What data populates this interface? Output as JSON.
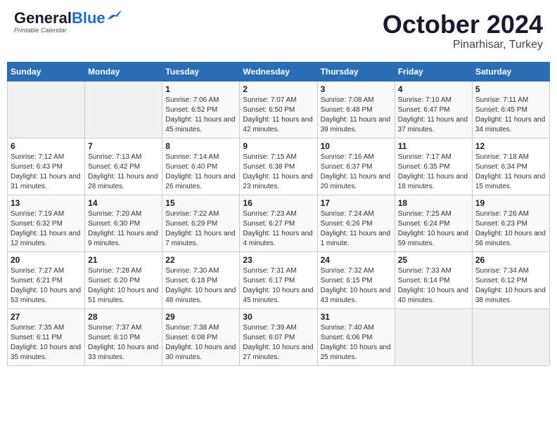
{
  "header": {
    "logo_general": "General",
    "logo_blue": "Blue",
    "month": "October 2024",
    "location": "Pinarhisar, Turkey"
  },
  "days_of_week": [
    "Sunday",
    "Monday",
    "Tuesday",
    "Wednesday",
    "Thursday",
    "Friday",
    "Saturday"
  ],
  "weeks": [
    [
      {
        "day": "",
        "sunrise": "",
        "sunset": "",
        "daylight": ""
      },
      {
        "day": "",
        "sunrise": "",
        "sunset": "",
        "daylight": ""
      },
      {
        "day": "1",
        "sunrise": "Sunrise: 7:06 AM",
        "sunset": "Sunset: 6:52 PM",
        "daylight": "Daylight: 11 hours and 45 minutes."
      },
      {
        "day": "2",
        "sunrise": "Sunrise: 7:07 AM",
        "sunset": "Sunset: 6:50 PM",
        "daylight": "Daylight: 11 hours and 42 minutes."
      },
      {
        "day": "3",
        "sunrise": "Sunrise: 7:08 AM",
        "sunset": "Sunset: 6:48 PM",
        "daylight": "Daylight: 11 hours and 39 minutes."
      },
      {
        "day": "4",
        "sunrise": "Sunrise: 7:10 AM",
        "sunset": "Sunset: 6:47 PM",
        "daylight": "Daylight: 11 hours and 37 minutes."
      },
      {
        "day": "5",
        "sunrise": "Sunrise: 7:11 AM",
        "sunset": "Sunset: 6:45 PM",
        "daylight": "Daylight: 11 hours and 34 minutes."
      }
    ],
    [
      {
        "day": "6",
        "sunrise": "Sunrise: 7:12 AM",
        "sunset": "Sunset: 6:43 PM",
        "daylight": "Daylight: 11 hours and 31 minutes."
      },
      {
        "day": "7",
        "sunrise": "Sunrise: 7:13 AM",
        "sunset": "Sunset: 6:42 PM",
        "daylight": "Daylight: 11 hours and 28 minutes."
      },
      {
        "day": "8",
        "sunrise": "Sunrise: 7:14 AM",
        "sunset": "Sunset: 6:40 PM",
        "daylight": "Daylight: 11 hours and 26 minutes."
      },
      {
        "day": "9",
        "sunrise": "Sunrise: 7:15 AM",
        "sunset": "Sunset: 6:38 PM",
        "daylight": "Daylight: 11 hours and 23 minutes."
      },
      {
        "day": "10",
        "sunrise": "Sunrise: 7:16 AM",
        "sunset": "Sunset: 6:37 PM",
        "daylight": "Daylight: 11 hours and 20 minutes."
      },
      {
        "day": "11",
        "sunrise": "Sunrise: 7:17 AM",
        "sunset": "Sunset: 6:35 PM",
        "daylight": "Daylight: 11 hours and 18 minutes."
      },
      {
        "day": "12",
        "sunrise": "Sunrise: 7:18 AM",
        "sunset": "Sunset: 6:34 PM",
        "daylight": "Daylight: 11 hours and 15 minutes."
      }
    ],
    [
      {
        "day": "13",
        "sunrise": "Sunrise: 7:19 AM",
        "sunset": "Sunset: 6:32 PM",
        "daylight": "Daylight: 11 hours and 12 minutes."
      },
      {
        "day": "14",
        "sunrise": "Sunrise: 7:20 AM",
        "sunset": "Sunset: 6:30 PM",
        "daylight": "Daylight: 11 hours and 9 minutes."
      },
      {
        "day": "15",
        "sunrise": "Sunrise: 7:22 AM",
        "sunset": "Sunset: 6:29 PM",
        "daylight": "Daylight: 11 hours and 7 minutes."
      },
      {
        "day": "16",
        "sunrise": "Sunrise: 7:23 AM",
        "sunset": "Sunset: 6:27 PM",
        "daylight": "Daylight: 11 hours and 4 minutes."
      },
      {
        "day": "17",
        "sunrise": "Sunrise: 7:24 AM",
        "sunset": "Sunset: 6:26 PM",
        "daylight": "Daylight: 11 hours and 1 minute."
      },
      {
        "day": "18",
        "sunrise": "Sunrise: 7:25 AM",
        "sunset": "Sunset: 6:24 PM",
        "daylight": "Daylight: 10 hours and 59 minutes."
      },
      {
        "day": "19",
        "sunrise": "Sunrise: 7:26 AM",
        "sunset": "Sunset: 6:23 PM",
        "daylight": "Daylight: 10 hours and 56 minutes."
      }
    ],
    [
      {
        "day": "20",
        "sunrise": "Sunrise: 7:27 AM",
        "sunset": "Sunset: 6:21 PM",
        "daylight": "Daylight: 10 hours and 53 minutes."
      },
      {
        "day": "21",
        "sunrise": "Sunrise: 7:28 AM",
        "sunset": "Sunset: 6:20 PM",
        "daylight": "Daylight: 10 hours and 51 minutes."
      },
      {
        "day": "22",
        "sunrise": "Sunrise: 7:30 AM",
        "sunset": "Sunset: 6:18 PM",
        "daylight": "Daylight: 10 hours and 48 minutes."
      },
      {
        "day": "23",
        "sunrise": "Sunrise: 7:31 AM",
        "sunset": "Sunset: 6:17 PM",
        "daylight": "Daylight: 10 hours and 45 minutes."
      },
      {
        "day": "24",
        "sunrise": "Sunrise: 7:32 AM",
        "sunset": "Sunset: 6:15 PM",
        "daylight": "Daylight: 10 hours and 43 minutes."
      },
      {
        "day": "25",
        "sunrise": "Sunrise: 7:33 AM",
        "sunset": "Sunset: 6:14 PM",
        "daylight": "Daylight: 10 hours and 40 minutes."
      },
      {
        "day": "26",
        "sunrise": "Sunrise: 7:34 AM",
        "sunset": "Sunset: 6:12 PM",
        "daylight": "Daylight: 10 hours and 38 minutes."
      }
    ],
    [
      {
        "day": "27",
        "sunrise": "Sunrise: 7:35 AM",
        "sunset": "Sunset: 6:11 PM",
        "daylight": "Daylight: 10 hours and 35 minutes."
      },
      {
        "day": "28",
        "sunrise": "Sunrise: 7:37 AM",
        "sunset": "Sunset: 6:10 PM",
        "daylight": "Daylight: 10 hours and 33 minutes."
      },
      {
        "day": "29",
        "sunrise": "Sunrise: 7:38 AM",
        "sunset": "Sunset: 6:08 PM",
        "daylight": "Daylight: 10 hours and 30 minutes."
      },
      {
        "day": "30",
        "sunrise": "Sunrise: 7:39 AM",
        "sunset": "Sunset: 6:07 PM",
        "daylight": "Daylight: 10 hours and 27 minutes."
      },
      {
        "day": "31",
        "sunrise": "Sunrise: 7:40 AM",
        "sunset": "Sunset: 6:06 PM",
        "daylight": "Daylight: 10 hours and 25 minutes."
      },
      {
        "day": "",
        "sunrise": "",
        "sunset": "",
        "daylight": ""
      },
      {
        "day": "",
        "sunrise": "",
        "sunset": "",
        "daylight": ""
      }
    ]
  ]
}
